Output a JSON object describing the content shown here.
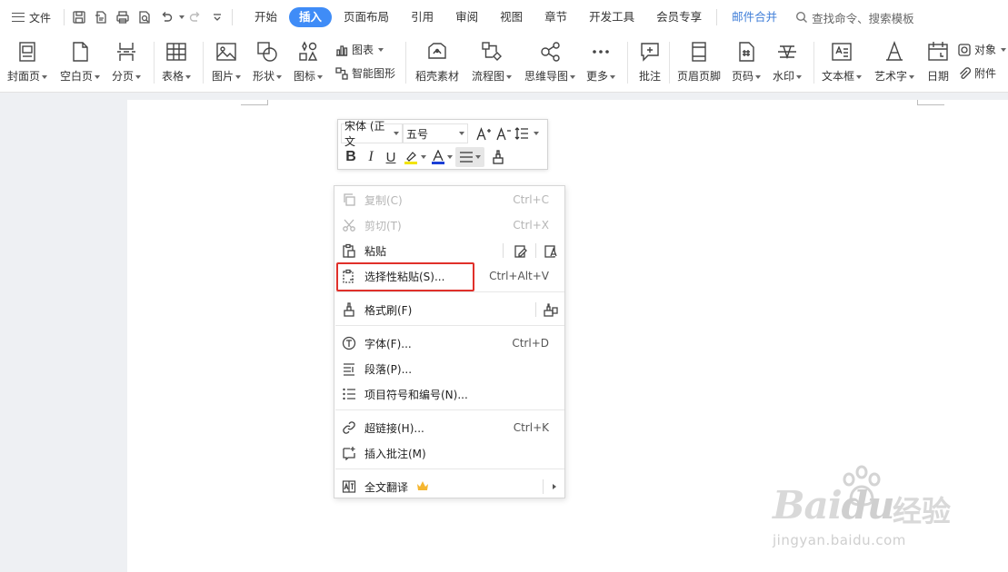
{
  "topbar": {
    "file_label": "文件",
    "tabs": [
      {
        "label": "开始"
      },
      {
        "label": "插入"
      },
      {
        "label": "页面布局"
      },
      {
        "label": "引用"
      },
      {
        "label": "审阅"
      },
      {
        "label": "视图"
      },
      {
        "label": "章节"
      },
      {
        "label": "开发工具"
      },
      {
        "label": "会员专享"
      }
    ],
    "active_tab": "插入",
    "mail_merge_label": "邮件合并",
    "search_placeholder": "查找命令、搜索模板"
  },
  "ribbon": {
    "cover_page": "封面页",
    "blank_page": "空白页",
    "page_break": "分页",
    "table": "表格",
    "picture": "图片",
    "shape": "形状",
    "icon": "图标",
    "chart": "图表",
    "smart_graphic": "智能图形",
    "daoke_material": "稻壳素材",
    "flowchart": "流程图",
    "mindmap": "思维导图",
    "more": "更多",
    "comment": "批注",
    "header_footer": "页眉页脚",
    "page_number": "页码",
    "watermark": "水印",
    "textbox": "文本框",
    "wordart": "艺术字",
    "date": "日期",
    "object": "对象",
    "attachment": "附件"
  },
  "minibar": {
    "font_name": "宋体 (正文",
    "font_size": "五号"
  },
  "context_menu": {
    "copy": {
      "label": "复制(C)",
      "shortcut": "Ctrl+C"
    },
    "cut": {
      "label": "剪切(T)",
      "shortcut": "Ctrl+X"
    },
    "paste": {
      "label": "粘贴"
    },
    "paste_special": {
      "label": "选择性粘贴(S)...",
      "shortcut": "Ctrl+Alt+V"
    },
    "format_painter": {
      "label": "格式刷(F)"
    },
    "font": {
      "label": "字体(F)...",
      "shortcut": "Ctrl+D"
    },
    "paragraph": {
      "label": "段落(P)..."
    },
    "bullets": {
      "label": "项目符号和编号(N)..."
    },
    "hyperlink": {
      "label": "超链接(H)...",
      "shortcut": "Ctrl+K"
    },
    "insert_comment": {
      "label": "插入批注(M)"
    },
    "translate": {
      "label": "全文翻译"
    }
  },
  "colors": {
    "accent": "#3f8cf7",
    "highlight_box": "#e0302a",
    "disabled_text": "#b5b5b5"
  },
  "watermark": {
    "logo_latin": "Bai",
    "logo_latin2": "du",
    "logo_cn": "经验",
    "url": "jingyan.baidu.com"
  }
}
